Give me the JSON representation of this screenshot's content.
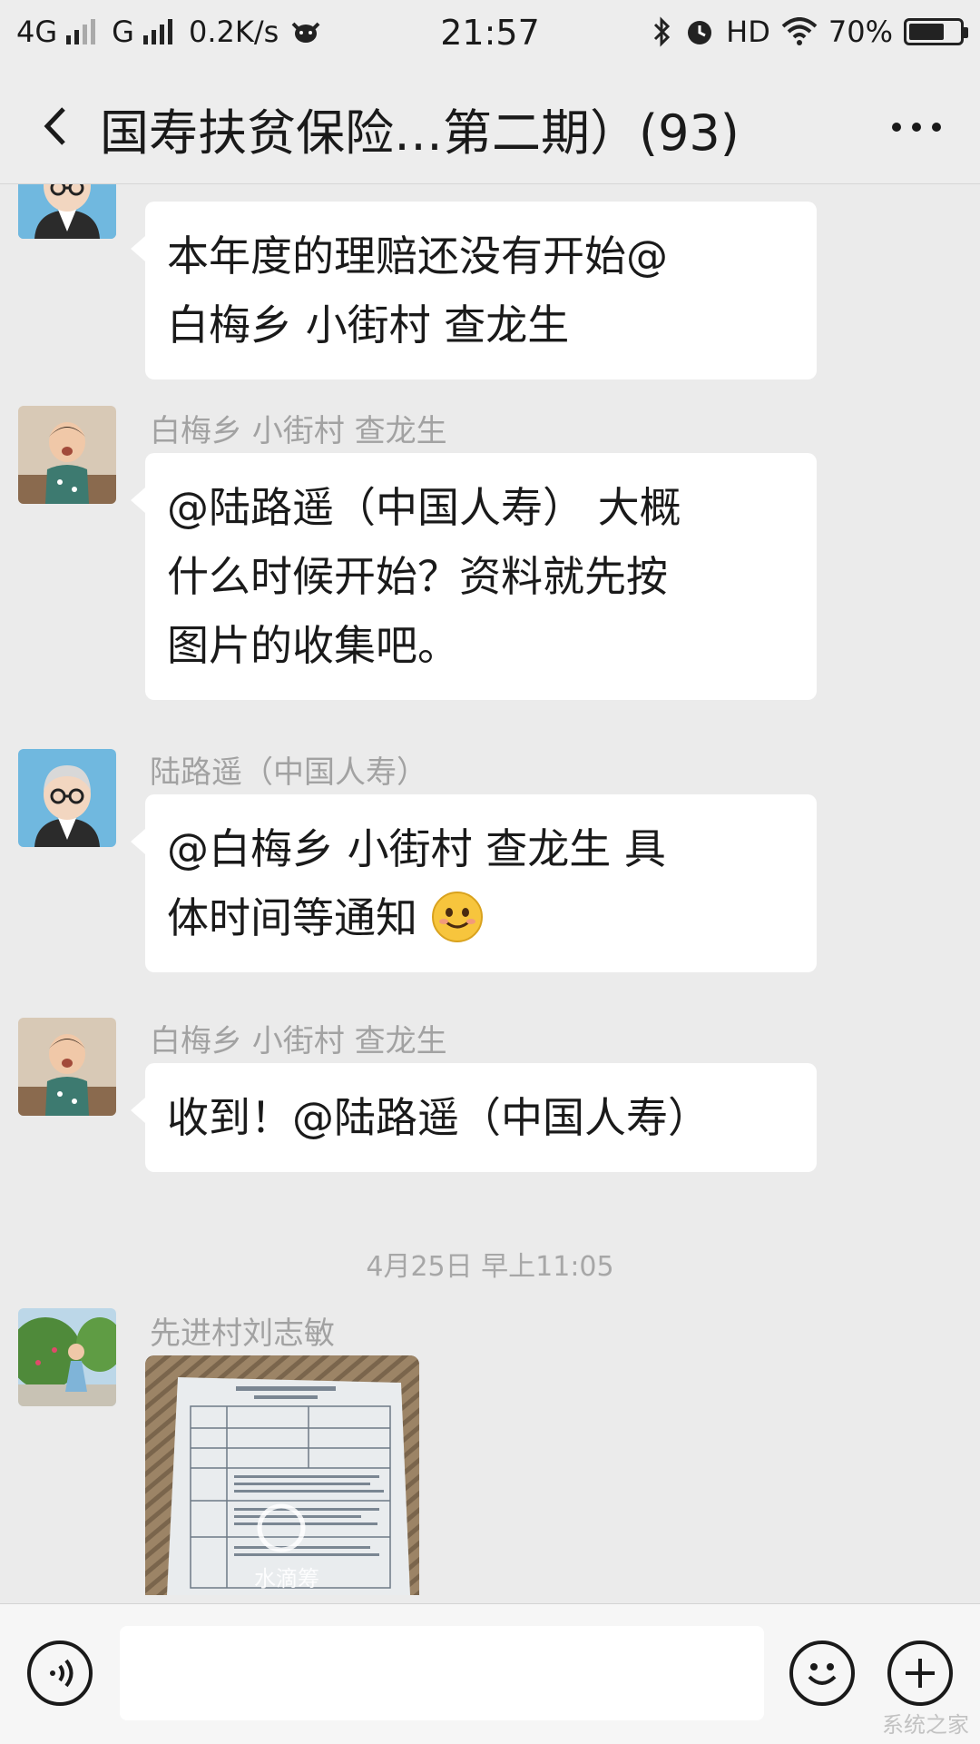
{
  "status_bar": {
    "network_1": "4G",
    "network_2": "G",
    "speed": "0.2K/s",
    "time": "21:57",
    "hd": "HD",
    "battery": "70%",
    "battery_level": 0.7,
    "icons": [
      "signal-icon",
      "cow-icon",
      "bluetooth-icon",
      "alarm-icon",
      "wifi-icon",
      "battery-icon"
    ]
  },
  "header": {
    "title": "国寿扶贫保险…第二期）(93)",
    "back_icon": "chevron-left-icon",
    "more_icon": "more-icon"
  },
  "messages": [
    {
      "sender": "",
      "text_lines": [
        "本年度的理赔还没有开始@",
        "白梅乡 小街村 查龙生"
      ]
    },
    {
      "sender": "白梅乡 小街村 查龙生",
      "text_lines": [
        "@陆路遥（中国人寿） 大概",
        "什么时候开始？资料就先按",
        "图片的收集吧。"
      ]
    },
    {
      "sender": "陆路遥（中国人寿）",
      "text_lines": [
        "@白梅乡 小街村 查龙生  具",
        "体时间等通知"
      ],
      "emoji": "smile-emoji"
    },
    {
      "sender": "白梅乡 小街村 查龙生",
      "text_lines": [
        "收到！@陆路遥（中国人寿）"
      ]
    }
  ],
  "timestamp": "4月25日 早上11:05",
  "image_message": {
    "sender": "先进村刘志敏",
    "watermark": "水滴筹"
  },
  "input_bar": {
    "voice_icon": "voice-icon",
    "emoji_icon": "emoji-icon",
    "plus_icon": "plus-icon",
    "text_value": ""
  },
  "corner_watermark": "系统之家"
}
